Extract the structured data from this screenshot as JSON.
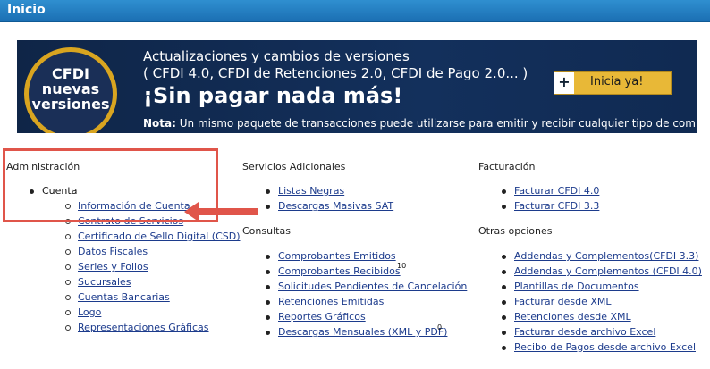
{
  "header": {
    "title": "Inicio"
  },
  "banner": {
    "badge_line1": "CFDI",
    "badge_line2": "nuevas",
    "badge_line3": "versiones",
    "line1": "Actualizaciones y cambios de versiones",
    "line2": "( CFDI 4.0, CFDI de Retenciones 2.0, CFDI de Pago 2.0... )",
    "headline": "¡Sin pagar nada más!",
    "note_label": "Nota:",
    "note_text": " Un mismo paquete de transacciones puede utilizarse para emitir y recibir cualquier tipo de comprobante.",
    "cta_plus": "+",
    "cta_label": "Inicia ya!"
  },
  "admin": {
    "title": "Administración",
    "section": "Cuenta",
    "items": [
      "Información de Cuenta",
      "Contrato de Servicios",
      "Certificado de Sello Digital (CSD)",
      "Datos Fiscales",
      "Series y Folios",
      "Sucursales",
      "Cuentas Bancarias",
      "Logo",
      "Representaciones Gráficas"
    ]
  },
  "servicios": {
    "title": "Servicios Adicionales",
    "items": [
      "Listas Negras",
      "Descargas Masivas SAT"
    ]
  },
  "consultas": {
    "title": "Consultas",
    "items": [
      "Comprobantes Emitidos",
      "Comprobantes Recibidos",
      "Solicitudes Pendientes de Cancelación",
      "Retenciones Emitidas",
      "Reportes Gráficos",
      "Descargas Mensuales (XML y PDF)"
    ],
    "recibidos_count": "10",
    "descargas_count": "0"
  },
  "facturacion": {
    "title": "Facturación",
    "items": [
      "Facturar CFDI 4.0",
      "Facturar CFDI 3.3"
    ]
  },
  "otras": {
    "title": "Otras opciones",
    "items": [
      "Addendas y Complementos(CFDI 3.3)",
      "Addendas y Complementos (CFDI 4.0)",
      "Plantillas de Documentos",
      "Facturar desde XML",
      "Retenciones desde XML",
      "Facturar desde archivo Excel",
      "Recibo de Pagos desde archivo Excel"
    ]
  }
}
